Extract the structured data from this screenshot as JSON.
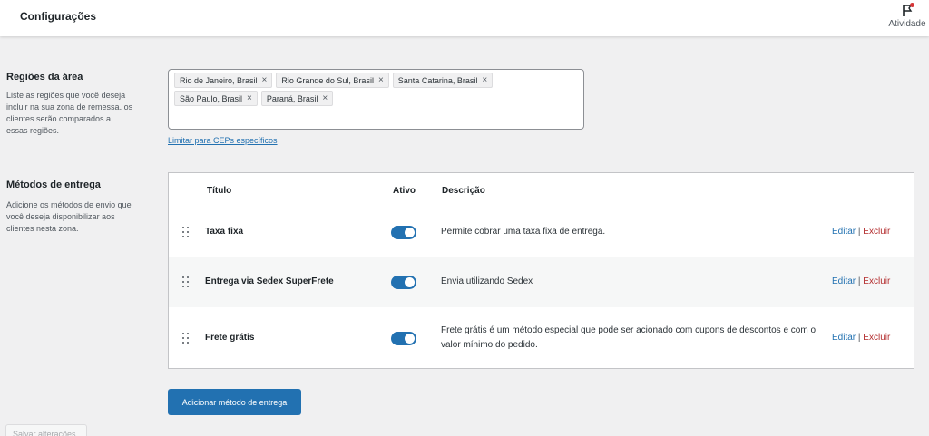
{
  "header": {
    "title": "Configurações",
    "activity_label": "Atividade"
  },
  "regions": {
    "title": "Regiões da área",
    "description": "Liste as regiões que você deseja incluir na sua zona de remessa. os clientes serão comparados a essas regiões.",
    "chips": [
      "Rio de Janeiro, Brasil",
      "Rio Grande do Sul, Brasil",
      "Santa Catarina, Brasil",
      "São Paulo, Brasil",
      "Paraná, Brasil"
    ],
    "remove_glyph": "×",
    "limit_link": "Limitar para CEPs específicos"
  },
  "methods": {
    "title": "Métodos de entrega",
    "description": "Adicione os métodos de envio que você deseja disponibilizar aos clientes nesta zona.",
    "columns": {
      "title": "Título",
      "active": "Ativo",
      "description": "Descrição"
    },
    "rows": [
      {
        "name": "Taxa fixa",
        "active": true,
        "description": "Permite cobrar uma taxa fixa de entrega."
      },
      {
        "name": "Entrega via Sedex SuperFrete",
        "active": true,
        "description": "Envia utilizando Sedex"
      },
      {
        "name": "Frete grátis",
        "active": true,
        "description": "Frete grátis é um método especial que pode ser acionado com cupons de descontos e com o valor mínimo do pedido."
      }
    ],
    "edit_label": "Editar",
    "separator": "|",
    "delete_label": "Excluir"
  },
  "buttons": {
    "add_method": "Adicionar método de entrega",
    "save": "Salvar alterações"
  },
  "colors": {
    "accent": "#2271b1",
    "danger": "#b32d2e",
    "notification": "#d63638"
  }
}
